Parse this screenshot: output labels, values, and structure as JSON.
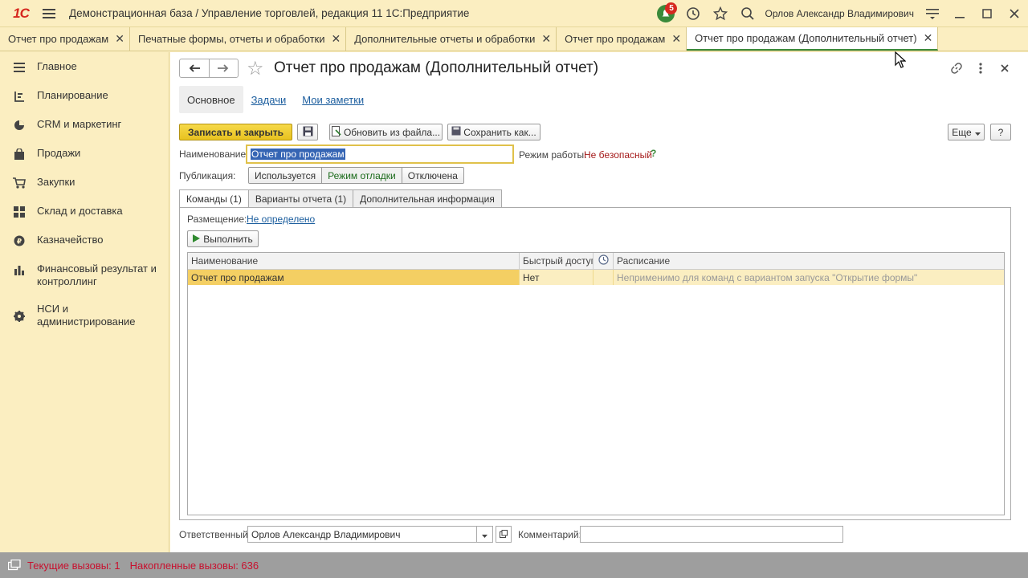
{
  "titlebar": {
    "logo": "1С",
    "title": "Демонстрационная база / Управление торговлей, редакция 11 1С:Предприятие",
    "notifications_count": "5",
    "user": "Орлов Александр Владимирович"
  },
  "tabs": [
    {
      "label": "Отчет про продажам"
    },
    {
      "label": "Печатные формы, отчеты и обработки"
    },
    {
      "label": "Дополнительные отчеты и обработки"
    },
    {
      "label": "Отчет про продажам"
    },
    {
      "label": "Отчет про продажам (Дополнительный отчет)"
    }
  ],
  "sidebar": {
    "items": [
      {
        "label": "Главное"
      },
      {
        "label": "Планирование"
      },
      {
        "label": "CRM и маркетинг"
      },
      {
        "label": "Продажи"
      },
      {
        "label": "Закупки"
      },
      {
        "label": "Склад и доставка"
      },
      {
        "label": "Казначейство"
      },
      {
        "label": "Финансовый результат и контроллинг"
      },
      {
        "label": "НСИ и администрирование"
      }
    ]
  },
  "form": {
    "title": "Отчет про продажам (Дополнительный отчет)",
    "subtabs": [
      "Основное",
      "Задачи",
      "Мои заметки"
    ],
    "toolbar": {
      "save_close": "Записать и закрыть",
      "update_from_file": "Обновить из файла...",
      "save_as": "Сохранить как...",
      "more": "Еще",
      "help": "?"
    },
    "name_label": "Наименование:",
    "name_value": "Отчет про продажам",
    "mode_label": "Режим работы:",
    "mode_value": "Не безопасный",
    "mode_help": "?",
    "publication_label": "Публикация:",
    "publication_options": [
      "Используется",
      "Режим отладки",
      "Отключена"
    ],
    "inner_tabs": [
      "Команды (1)",
      "Варианты отчета (1)",
      "Дополнительная информация"
    ],
    "placement_label": "Размещение:",
    "placement_value": "Не определено",
    "run_button": "Выполнить",
    "grid": {
      "headers": [
        "Наименование",
        "Быстрый доступ",
        "",
        "Расписание"
      ],
      "rows": [
        {
          "name": "Отчет про продажам",
          "quick": "Нет",
          "sched_icon": "",
          "schedule": "Неприменимо для команд с вариантом запуска \"Открытие формы\""
        }
      ]
    },
    "responsible_label": "Ответственный:",
    "responsible_value": "Орлов Александр Владимирович",
    "comment_label": "Комментарий:",
    "comment_value": ""
  },
  "statusbar": {
    "current_calls": "Текущие вызовы: 1",
    "accumulated_calls": "Накопленные вызовы: 636"
  },
  "colors": {
    "panel_bg": "#fbeec1",
    "accent_green": "#3c8a3c",
    "primary_button": "#e8c21f",
    "status_text": "#c8102e"
  }
}
